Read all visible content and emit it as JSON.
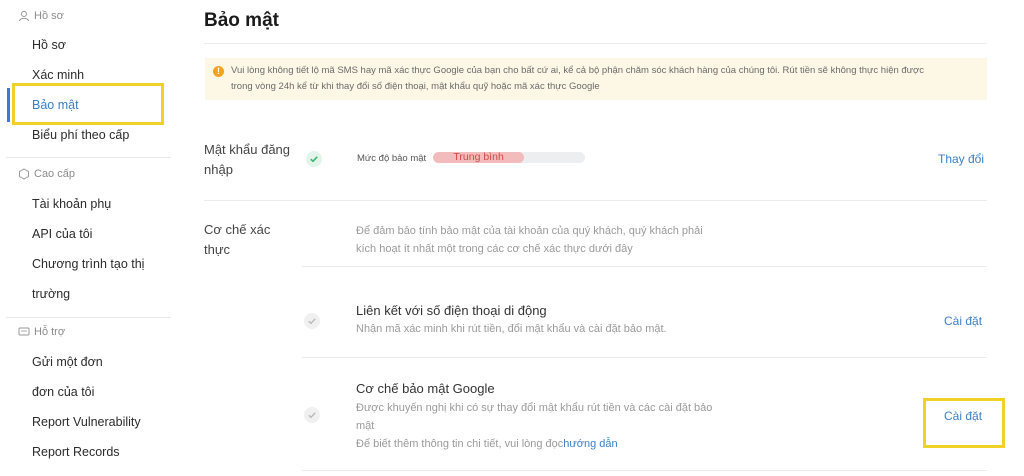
{
  "sidebar": {
    "sections": [
      {
        "heading": "Hồ sơ",
        "icon": "user-icon"
      },
      {
        "heading": "Cao cấp",
        "icon": "hexagon-icon"
      },
      {
        "heading": "Hỗ trợ",
        "icon": "message-icon"
      }
    ],
    "items": [
      "Hồ sơ",
      "Xác minh",
      "Bảo mật",
      "Biểu phí theo cấp",
      "Tài khoản phụ",
      "API của tôi",
      "Chương trình tạo thị",
      "trường",
      "Gửi một đơn",
      "đơn của tôi",
      "Report Vulnerability",
      "Report Records"
    ],
    "active_item": "Bảo mật"
  },
  "main": {
    "title": "Bảo mật",
    "notice": {
      "icon": "warning-icon",
      "line1": "Vui lòng không tiết lộ mã SMS hay mã xác thực Google của bạn cho bất cứ ai, kể cả bộ phận chăm sóc khách hàng của chúng tôi. Rút tiền sẽ không thực hiện được",
      "line2": "trong vòng 24h kể từ khi thay đổi số điện thoại, mật khẩu quỹ hoặc mã xác thực Google"
    },
    "login_password": {
      "label_line1": "Mật khẩu đăng",
      "label_line2": "nhập",
      "level_label": "Mức độ bảo mật",
      "level_value": "Trung bình",
      "level_fraction": 0.6,
      "action": "Thay đổi"
    },
    "auth_mechanism": {
      "label_line1": "Cơ chế xác",
      "label_line2": "thực",
      "desc_line1": "Để đảm bảo tính bảo mật của tài khoản của quý khách, quý khách phải",
      "desc_line2": "kích hoạt ít nhất một trong các cơ chế xác thực dưới đây"
    },
    "phone": {
      "title": "Liên kết với số điện thoại di động",
      "desc": "Nhận mã xác minh khi rút tiền, đổi mật khẩu và cài đặt bảo mật.",
      "action": "Cài đặt"
    },
    "google": {
      "title": "Cơ chế bảo mật Google",
      "desc_line1": "Được khuyến nghị khi có sự thay đổi mật khẩu rút tiền và các cài đặt bảo",
      "desc_line2": "mật",
      "desc_line3_prefix": "Để biết thêm thông tin chi tiết, vui lòng đọc",
      "desc_line3_link": "hướng dẫn",
      "action": "Cài đặt"
    }
  },
  "colors": {
    "accent": "#3b7fc4",
    "highlight": "#f0d12a",
    "notice_bg": "#fdf7e6",
    "meter_fill": "#f2bcbc",
    "meter_text": "#d04848",
    "check_active": "#3cb371"
  }
}
